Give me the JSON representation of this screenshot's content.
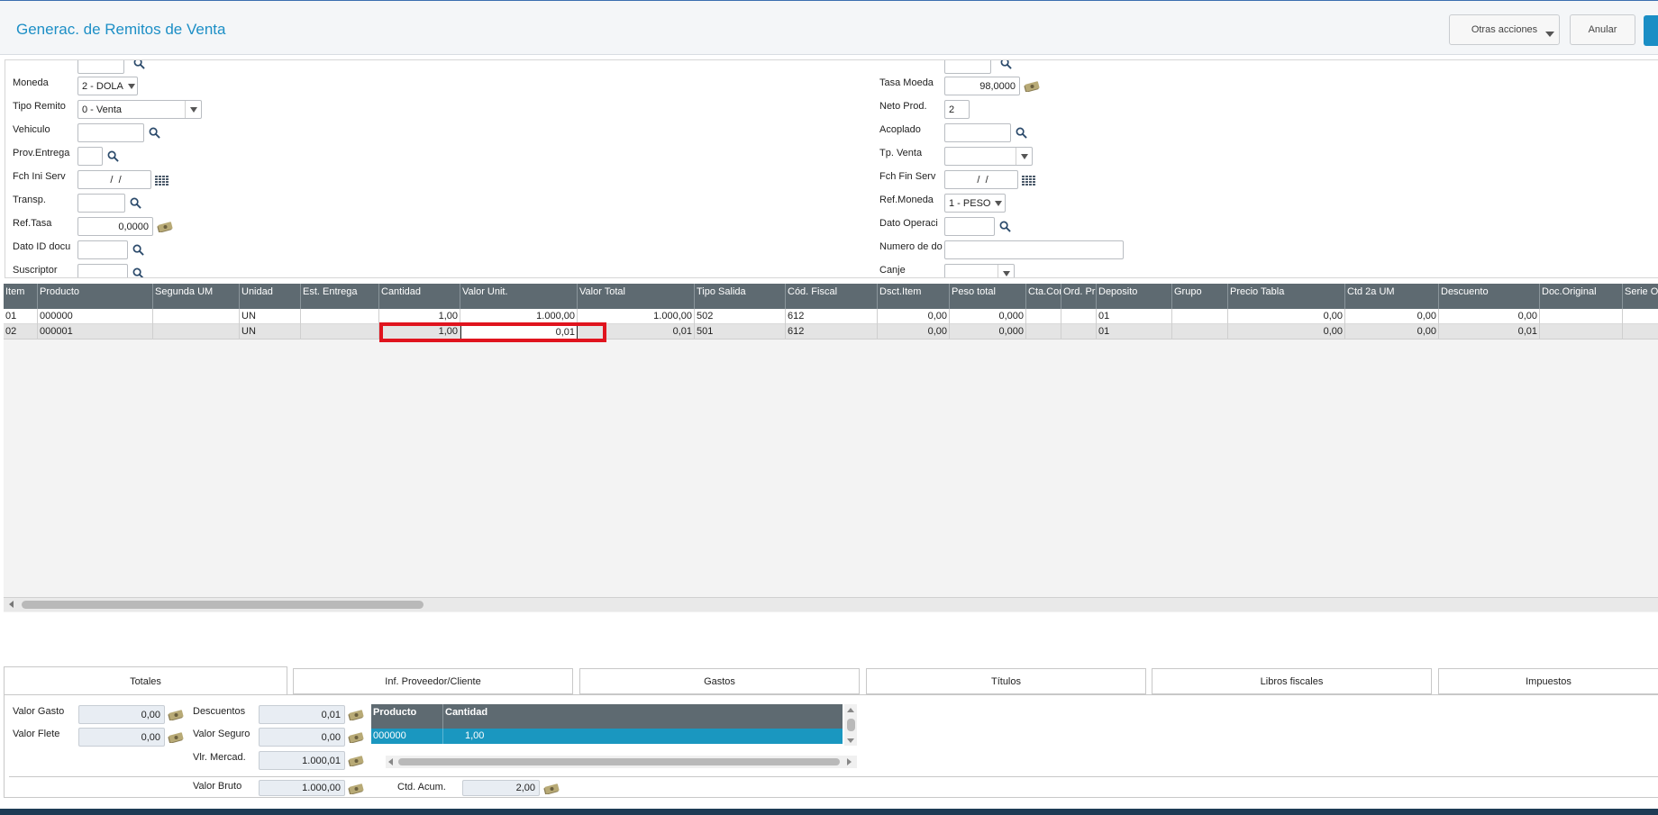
{
  "app": {
    "title": "Generac. de Remitos de Venta"
  },
  "toolbar": {
    "other_actions": "Otras acciones",
    "cancel": "Anular"
  },
  "form": {
    "left": [
      {
        "label": "Moneda",
        "value": "2 - DOLA"
      },
      {
        "label": "Tipo Remito",
        "value": "0 - Venta"
      },
      {
        "label": "Vehiculo",
        "value": ""
      },
      {
        "label": "Prov.Entrega",
        "value": ""
      },
      {
        "label": "Fch Ini Serv",
        "value": " /  /"
      },
      {
        "label": "Transp.",
        "value": ""
      },
      {
        "label": "Ref.Tasa",
        "value": "0,0000"
      },
      {
        "label": "Dato ID docu",
        "value": ""
      },
      {
        "label": "Suscriptor",
        "value": ""
      }
    ],
    "right": [
      {
        "label": "Tasa Moeda",
        "value": "98,0000"
      },
      {
        "label": "Neto Prod.",
        "value": "2"
      },
      {
        "label": "Acoplado",
        "value": ""
      },
      {
        "label": "Tp. Venta",
        "value": ""
      },
      {
        "label": "Fch Fin Serv",
        "value": " /  /"
      },
      {
        "label": "Ref.Moneda",
        "value": "1 - PESO"
      },
      {
        "label": "Dato Operaci",
        "value": ""
      },
      {
        "label": "Numero de do",
        "value": ""
      },
      {
        "label": "Canje",
        "value": ""
      }
    ]
  },
  "grid": {
    "headers": [
      "Item",
      "Producto",
      "Segunda UM",
      "Unidad",
      "Est. Entrega",
      "Cantidad",
      "Valor Unit.",
      "Valor Total",
      "Tipo Salida",
      "Cód. Fiscal",
      "Dsct.Item",
      "Peso total",
      "Cta.Con",
      "Ord. Pr",
      "Deposito",
      "Grupo",
      "Precio Tabla",
      "Ctd 2a UM",
      "Descuento",
      "Doc.Original",
      "Serie Or"
    ],
    "rows": [
      [
        "01",
        "000000",
        "",
        "UN",
        "",
        "1,00",
        "1.000,00",
        "1.000,00",
        "502",
        "612",
        "0,00",
        "0,000",
        "",
        "",
        "01",
        "",
        "0,00",
        "0,00",
        "0,00",
        "",
        ""
      ],
      [
        "02",
        "000001",
        "",
        "UN",
        "",
        "1,00",
        "0,01",
        "0,01",
        "501",
        "612",
        "0,00",
        "0,000",
        "",
        "",
        "01",
        "",
        "0,00",
        "0,00",
        "0,01",
        "",
        ""
      ]
    ]
  },
  "tabs": [
    "Totales",
    "Inf. Proveedor/Cliente",
    "Gastos",
    "Títulos",
    "Libros fiscales",
    "Impuestos"
  ],
  "totals": {
    "valor_gasto_label": "Valor Gasto",
    "valor_gasto": "0,00",
    "valor_flete_label": "Valor Flete",
    "valor_flete": "0,00",
    "descuentos_label": "Descuentos",
    "descuentos": "0,01",
    "valor_seguro_label": "Valor Seguro",
    "valor_seguro": "0,00",
    "vlr_mercad_label": "Vlr. Mercad.",
    "vlr_mercad": "1.000,01",
    "valor_bruto_label": "Valor Bruto",
    "valor_bruto": "1.000,00",
    "ctd_acum_label": "Ctd. Acum.",
    "ctd_acum": "2,00",
    "mini_headers": [
      "Producto",
      "Cantidad"
    ],
    "mini_row": [
      "000000",
      "1,00"
    ]
  },
  "colors": {
    "accent": "#1d8fc6",
    "grid_header": "#5e6a71",
    "highlight": "#e0141e",
    "mini_row": "#1a97c0"
  }
}
